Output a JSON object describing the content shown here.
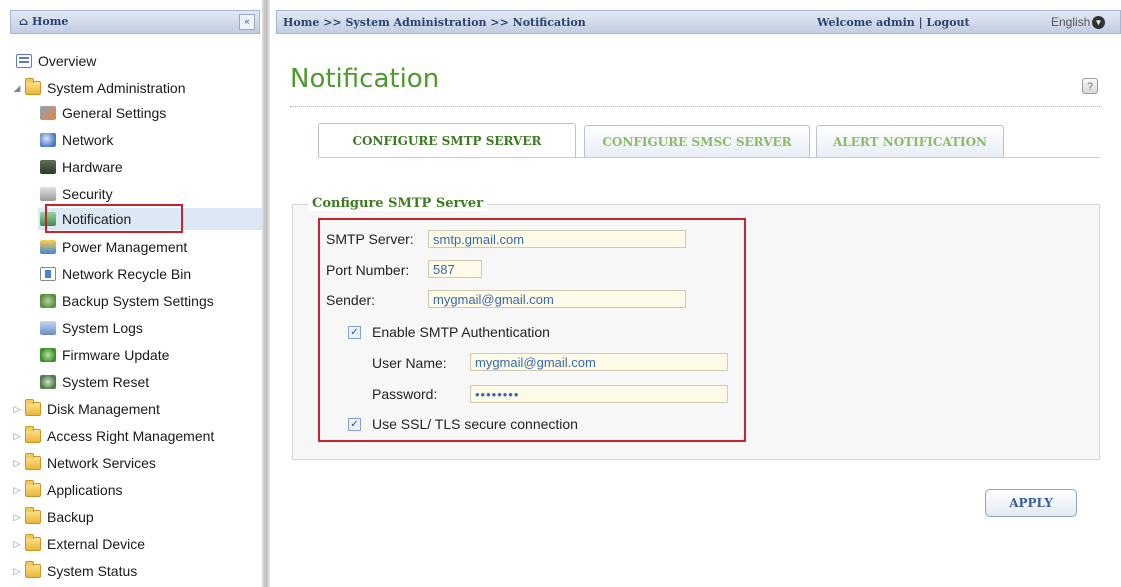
{
  "sidebar": {
    "header_title": "Home",
    "collapse_label": "«",
    "items": [
      {
        "label": "Overview",
        "icon": "overview-icon"
      },
      {
        "label": "System Administration",
        "icon": "folder-icon",
        "expanded": true
      },
      {
        "label": "General Settings",
        "icon": "general-settings-icon"
      },
      {
        "label": "Network",
        "icon": "network-icon"
      },
      {
        "label": "Hardware",
        "icon": "hardware-icon"
      },
      {
        "label": "Security",
        "icon": "security-icon"
      },
      {
        "label": "Notification",
        "icon": "notification-icon",
        "selected": true
      },
      {
        "label": "Power Management",
        "icon": "power-icon"
      },
      {
        "label": "Network Recycle Bin",
        "icon": "recycle-bin-icon"
      },
      {
        "label": "Backup System Settings",
        "icon": "backup-icon"
      },
      {
        "label": "System Logs",
        "icon": "logs-icon"
      },
      {
        "label": "Firmware Update",
        "icon": "firmware-icon"
      },
      {
        "label": "System Reset",
        "icon": "reset-icon"
      },
      {
        "label": "Disk Management",
        "icon": "folder-icon"
      },
      {
        "label": "Access Right Management",
        "icon": "folder-icon"
      },
      {
        "label": "Network Services",
        "icon": "folder-icon"
      },
      {
        "label": "Applications",
        "icon": "folder-icon"
      },
      {
        "label": "Backup",
        "icon": "folder-icon"
      },
      {
        "label": "External Device",
        "icon": "folder-icon"
      },
      {
        "label": "System Status",
        "icon": "folder-icon"
      }
    ]
  },
  "topbar": {
    "breadcrumb": "Home >> System Administration >> Notification",
    "welcome": "Welcome admin | Logout",
    "language": "English"
  },
  "main": {
    "title": "Notification",
    "help_glyph": "?",
    "tabs": [
      {
        "label": "CONFIGURE SMTP SERVER",
        "active": true
      },
      {
        "label": "CONFIGURE SMSC SERVER",
        "active": false
      },
      {
        "label": "ALERT NOTIFICATION",
        "active": false
      }
    ],
    "section_title": "Configure SMTP Server",
    "form": {
      "smtp_server_label": "SMTP Server:",
      "smtp_server_value": "smtp.gmail.com",
      "port_label": "Port Number:",
      "port_value": "587",
      "sender_label": "Sender:",
      "sender_value": "mygmail@gmail.com",
      "auth_label": "Enable SMTP Authentication",
      "auth_checked": true,
      "username_label": "User Name:",
      "username_value": "mygmail@gmail.com",
      "password_label": "Password:",
      "password_value": "••••••••",
      "ssl_label": "Use SSL/ TLS secure connection",
      "ssl_checked": true
    },
    "apply_label": "APPLY"
  },
  "colors": {
    "accent_green": "#4e9a2e",
    "highlight_red": "#c9212d",
    "header_blue": "#29446f"
  }
}
